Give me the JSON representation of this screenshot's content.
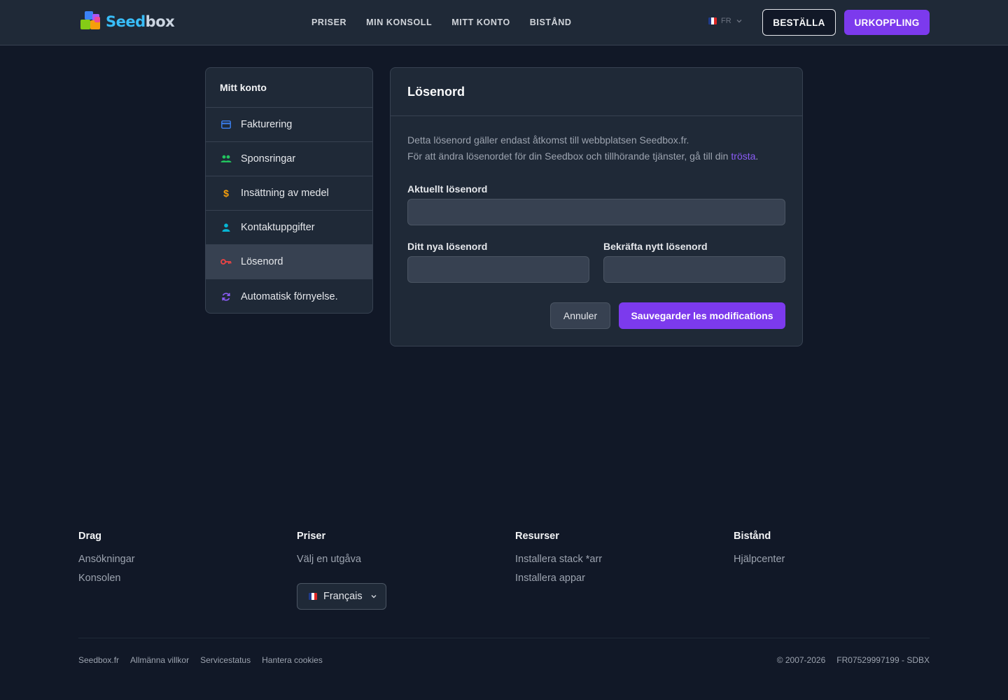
{
  "header": {
    "logo": {
      "part1": "Seed",
      "part2": "box"
    },
    "nav": [
      "PRISER",
      "MIN KONSOLL",
      "MITT KONTO",
      "BISTÅND"
    ],
    "lang": "FR",
    "order_label": "BESTÄLLA",
    "logout_label": "URKOPPLING"
  },
  "sidebar": {
    "title": "Mitt konto",
    "items": [
      {
        "label": "Fakturering",
        "icon": "credit-card-icon",
        "color": "#3b82f6"
      },
      {
        "label": "Sponsringar",
        "icon": "users-icon",
        "color": "#22c55e"
      },
      {
        "label": "Insättning av medel",
        "icon": "dollar-icon",
        "color": "#f59e0b"
      },
      {
        "label": "Kontaktuppgifter",
        "icon": "user-icon",
        "color": "#06b6d4"
      },
      {
        "label": "Lösenord",
        "icon": "key-icon",
        "color": "#ef4444"
      },
      {
        "label": "Automatisk förnyelse.",
        "icon": "refresh-icon",
        "color": "#8b5cf6"
      }
    ]
  },
  "card": {
    "title": "Lösenord",
    "desc_line1": "Detta lösenord gäller endast åtkomst till webbplatsen Seedbox.fr.",
    "desc_line2": "För att ändra lösenordet för din Seedbox och tillhörande tjänster, gå till din",
    "desc_link": "trösta",
    "current_label": "Aktuellt lösenord",
    "current_value": "",
    "new_label": "Ditt nya lösenord",
    "new_value": "",
    "confirm_label": "Bekräfta nytt lösenord",
    "confirm_value": "",
    "cancel_label": "Annuler",
    "save_label": "Sauvegarder les modifications"
  },
  "footer": {
    "columns": [
      {
        "title": "Drag",
        "links": [
          "Ansökningar",
          "Konsolen"
        ]
      },
      {
        "title": "Priser",
        "links": [
          "Välj en utgåva"
        ]
      },
      {
        "title": "Resurser",
        "links": [
          "Installera stack *arr",
          "Installera appar"
        ]
      },
      {
        "title": "Bistånd",
        "links": [
          "Hjälpcenter"
        ]
      }
    ],
    "language": "Français",
    "bottom_links": [
      "Seedbox.fr",
      "Allmänna villkor",
      "Servicestatus",
      "Hantera cookies"
    ],
    "copyright": "© 2007-2026",
    "company_id": "FR07529997199 - SDBX"
  },
  "colors": {
    "accent": "#7c3aed",
    "link": "#8b5cf6",
    "background": "#111827",
    "panel": "#1f2937"
  }
}
